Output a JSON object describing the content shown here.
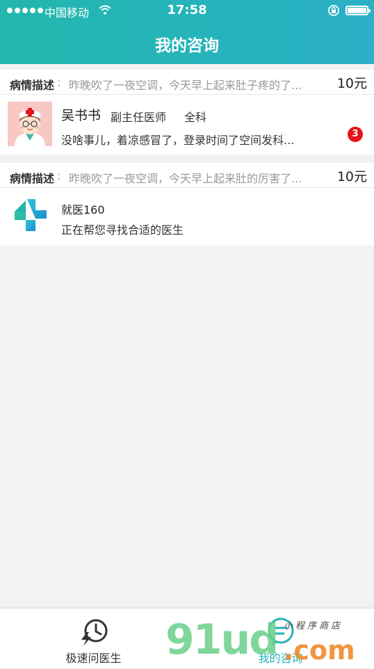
{
  "status_bar": {
    "carrier": "中国移动",
    "time": "17:58"
  },
  "header": {
    "title": "我的咨询"
  },
  "consultations": [
    {
      "desc_label": "病情描述",
      "desc_colon": ":",
      "description": "昨晚吹了一夜空调，今天早上起来肚子疼的了...",
      "price": "10元",
      "doctor_name": "吴书书",
      "doctor_title": "副主任医师",
      "department": "全科",
      "last_message": "没啥事儿，着凉感冒了，登录时间了空间发科...",
      "unread_count": "3"
    },
    {
      "desc_label": "病情描述",
      "desc_colon": ":",
      "description": "昨晚吹了一夜空调，今天早上起来肚的厉害了...",
      "price": "10元",
      "sender_name": "就医160",
      "status_message": "正在帮您寻找合适的医生"
    }
  ],
  "tabbar": {
    "tabs": [
      {
        "label": "极速问医生",
        "icon": "lightning-clock-icon",
        "active": false
      },
      {
        "label": "我的咨询",
        "icon": "chat-bubble-icon",
        "active": true
      }
    ]
  },
  "watermark": {
    "big": "91ud",
    "com": ".com",
    "small": "小程序商店"
  },
  "colors": {
    "header": "#26b3b8",
    "badge": "#e4141b",
    "active_tab": "#26b3b8"
  }
}
